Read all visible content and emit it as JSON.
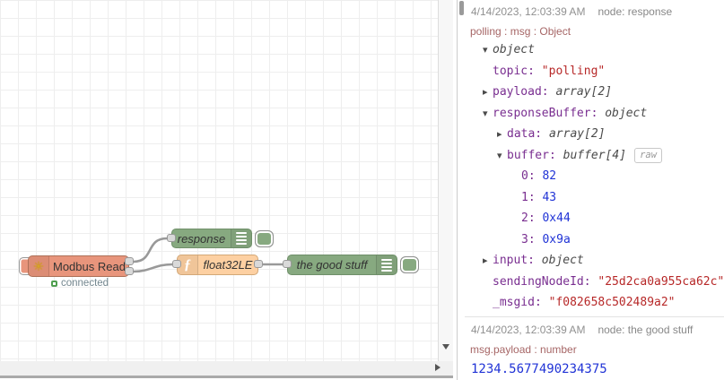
{
  "canvas": {
    "nodes": {
      "modbus": {
        "label": "Modbus Read",
        "icon": "✳",
        "status": "connected",
        "color": "#e8957c"
      },
      "response": {
        "label": "response",
        "color": "#87a980"
      },
      "func": {
        "label": "float32LE",
        "icon": "ƒ",
        "color": "#fdd0a2"
      },
      "goodstuff": {
        "label": "the good stuff",
        "color": "#87a980"
      }
    },
    "wire_color": "#999999",
    "status_green": "#4f9e4f"
  },
  "debug": {
    "raw_label": "raw",
    "colors": {
      "key": "#792e90",
      "string": "#b72828",
      "number": "#2033d6",
      "meta": "#a66666",
      "timestamp": "#909090"
    },
    "messages": [
      {
        "timestamp": "4/14/2023, 12:03:39 AM",
        "node": "node: response",
        "meta": "polling : msg : Object",
        "tree": [
          {
            "indent": 0,
            "caret": "down",
            "key": "",
            "value": "object",
            "vtype": "type"
          },
          {
            "indent": 0,
            "caret": "none",
            "key": "topic",
            "value": "\"polling\"",
            "vtype": "string"
          },
          {
            "indent": 0,
            "caret": "right",
            "key": "payload",
            "value": "array[2]",
            "vtype": "type"
          },
          {
            "indent": 0,
            "caret": "down",
            "key": "responseBuffer",
            "value": "object",
            "vtype": "type"
          },
          {
            "indent": 1,
            "caret": "right",
            "key": "data",
            "value": "array[2]",
            "vtype": "type"
          },
          {
            "indent": 1,
            "caret": "down",
            "key": "buffer",
            "value": "buffer[4]",
            "vtype": "type",
            "raw": true
          },
          {
            "indent": 2,
            "caret": "none",
            "key": "0",
            "value": "82",
            "vtype": "number"
          },
          {
            "indent": 2,
            "caret": "none",
            "key": "1",
            "value": "43",
            "vtype": "number"
          },
          {
            "indent": 2,
            "caret": "none",
            "key": "2",
            "value": "0x44",
            "vtype": "number"
          },
          {
            "indent": 2,
            "caret": "none",
            "key": "3",
            "value": "0x9a",
            "vtype": "number"
          },
          {
            "indent": 0,
            "caret": "right",
            "key": "input",
            "value": "object",
            "vtype": "type"
          },
          {
            "indent": 0,
            "caret": "none",
            "key": "sendingNodeId",
            "value": "\"25d2ca0a955ca62c\"",
            "vtype": "string"
          },
          {
            "indent": 0,
            "caret": "none",
            "key": "_msgid",
            "value": "\"f082658c502489a2\"",
            "vtype": "string"
          }
        ]
      },
      {
        "timestamp": "4/14/2023, 12:03:39 AM",
        "node": "node: the good stuff",
        "meta": "msg.payload : number",
        "value": "1234.5677490234375"
      }
    ]
  }
}
